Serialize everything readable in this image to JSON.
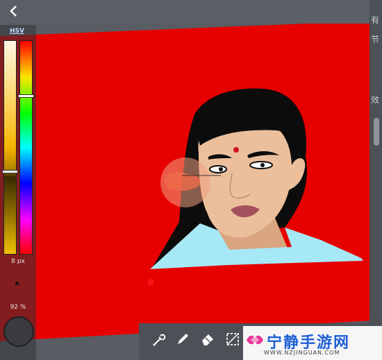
{
  "left_panel": {
    "color_mode_label": "HSV",
    "brush_size": "8 px",
    "opacity": "92 %"
  },
  "canvas": {
    "background_color": "#e60000",
    "hair_color": "#0c0c0c",
    "skin_color": "#ecbf9c",
    "shirt_color": "#a6e8f6",
    "lip_color": "#a4515d",
    "bindi_color": "#d3141c"
  },
  "right_strip": {
    "chars": [
      "有",
      "节",
      "效"
    ]
  },
  "toolbar": {
    "tools": [
      "eyedropper-icon",
      "brush-icon",
      "eraser-icon",
      "selection-icon"
    ]
  },
  "watermark": {
    "title": "宁静手游网",
    "subtitle": "WWW.NZJINGUAN.COM"
  }
}
